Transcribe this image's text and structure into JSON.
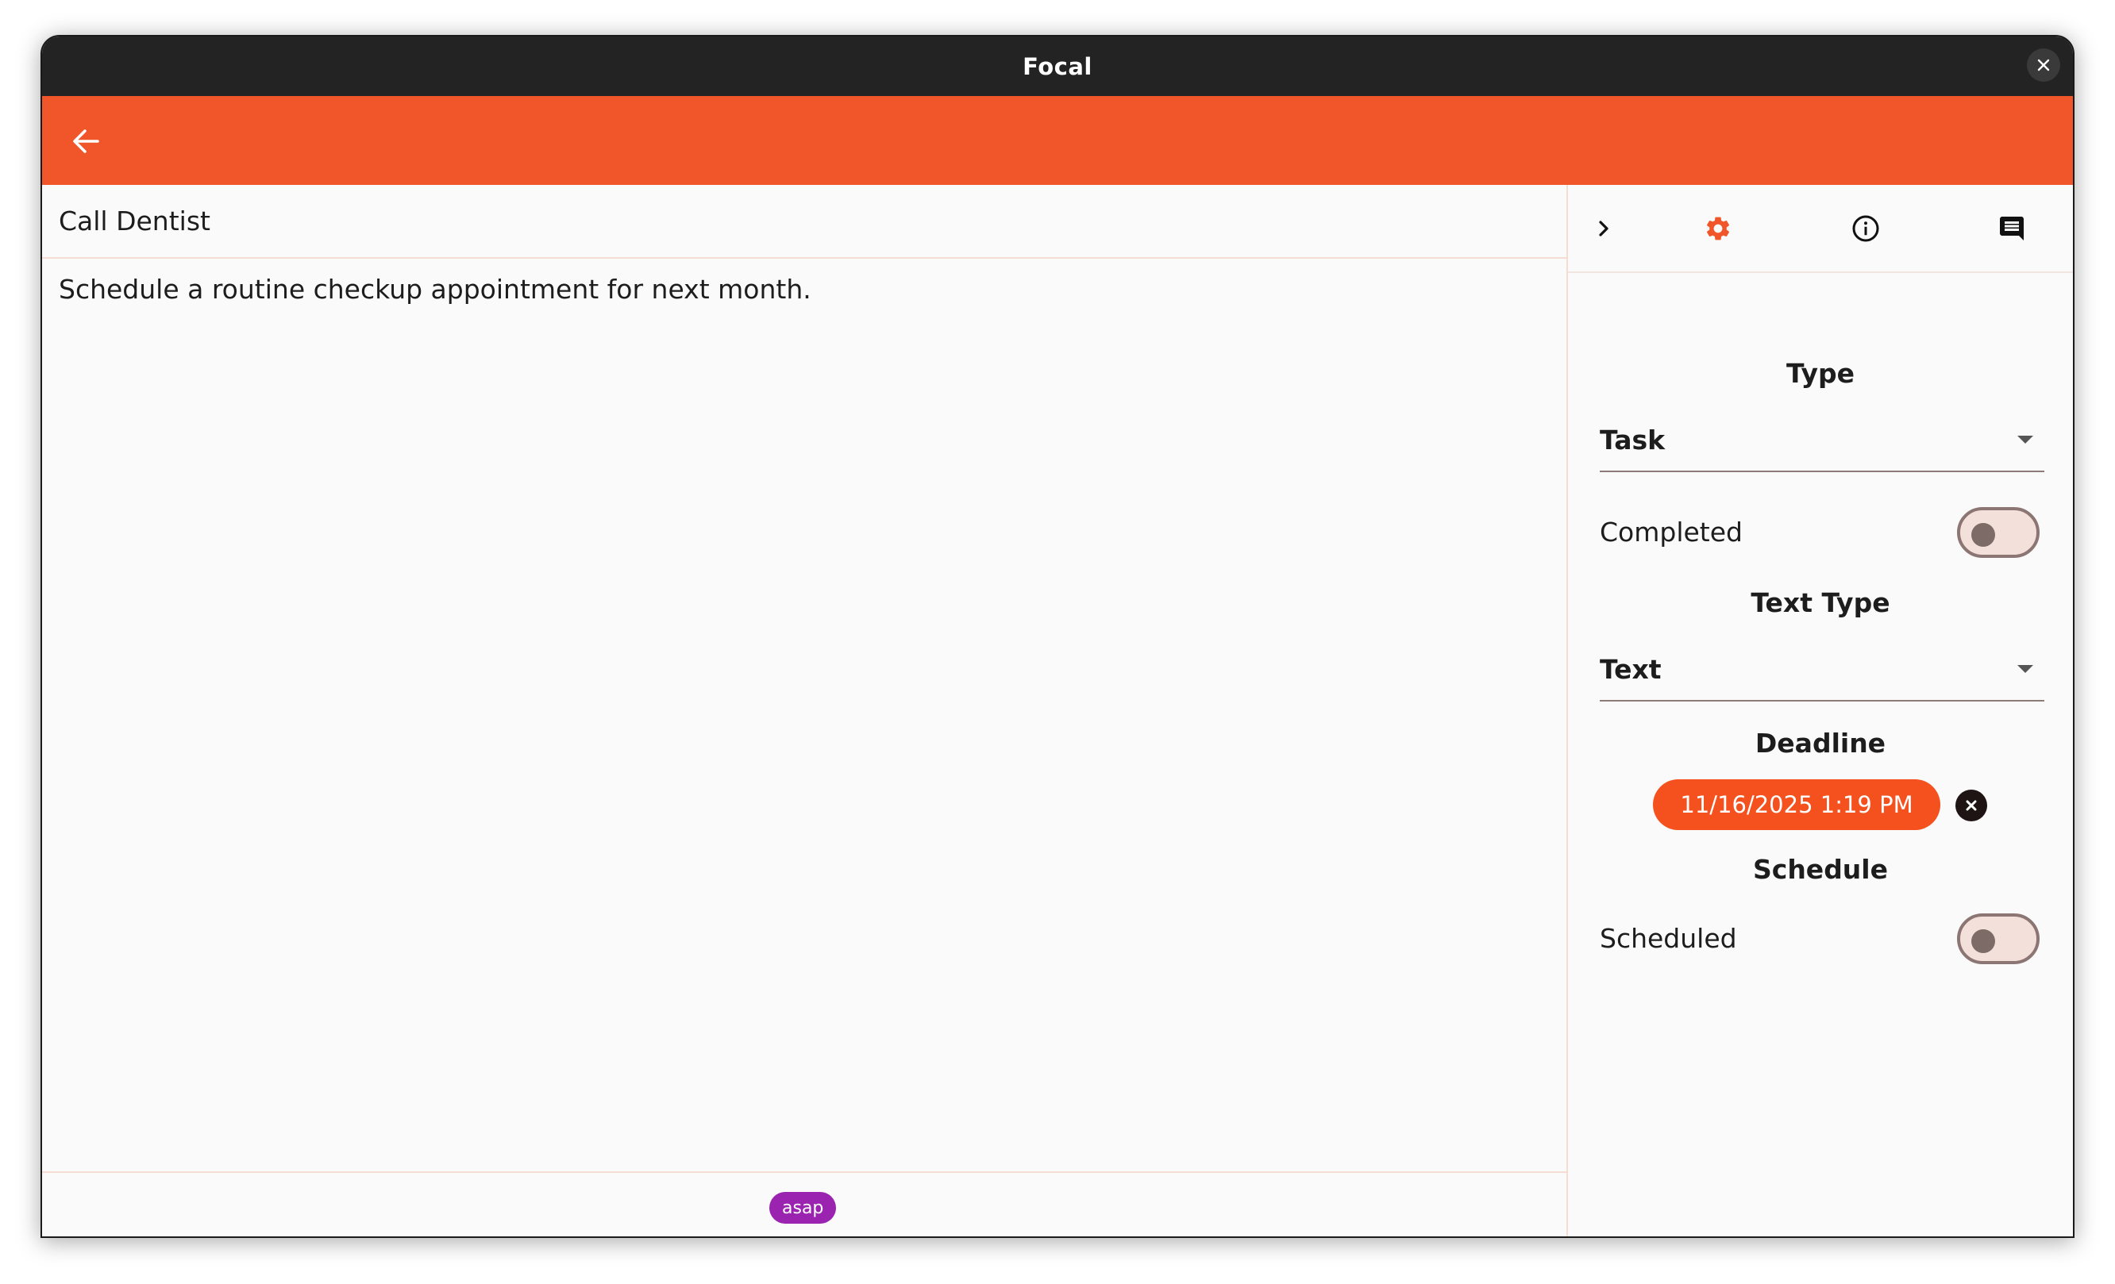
{
  "window": {
    "title": "Focal"
  },
  "note": {
    "title": "Call Dentist",
    "body": "Schedule a routine checkup appointment for next month.",
    "tags": [
      "asap"
    ]
  },
  "sidebar": {
    "tabs": [
      {
        "icon": "chevron-right-icon"
      },
      {
        "icon": "gear-icon",
        "active": true
      },
      {
        "icon": "info-icon"
      },
      {
        "icon": "comment-icon"
      }
    ],
    "type_heading": "Type",
    "type_value": "Task",
    "completed_label": "Completed",
    "completed_on": false,
    "text_type_heading": "Text Type",
    "text_type_value": "Text",
    "deadline_heading": "Deadline",
    "deadline_value": "11/16/2025 1:19 PM",
    "schedule_heading": "Schedule",
    "scheduled_label": "Scheduled",
    "scheduled_on": false
  },
  "colors": {
    "accent": "#f1562a",
    "titlebar": "#232323",
    "tag": "#9a23b0"
  }
}
